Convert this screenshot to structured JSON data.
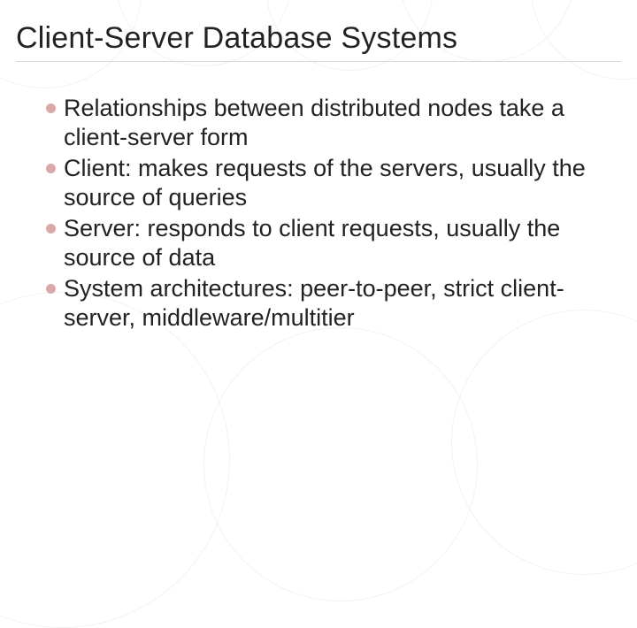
{
  "slide": {
    "title": "Client-Server Database Systems",
    "bullets": [
      "Relationships between distributed nodes take a client-server form",
      "Client: makes requests of the servers, usually the source of queries",
      "Server: responds to client requests, usually the source of data",
      "System architectures: peer-to-peer, strict client-server, middleware/multitier"
    ]
  }
}
